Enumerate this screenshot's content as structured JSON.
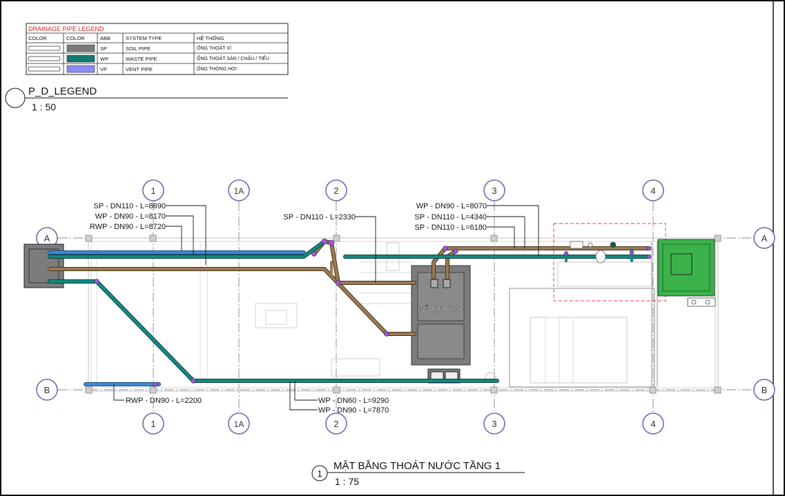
{
  "legend_table": {
    "title": "DRAINAGE PIPE LEGEND",
    "headers": [
      "COLOR",
      "COLOR",
      "ABB",
      "SYSTEM TYPE",
      "HỆ THỐNG"
    ],
    "rows": [
      {
        "abb": "SP",
        "system": "SOIL PIPE",
        "vn": "ỐNG THOÁT XÍ",
        "color": "#7a7a7a"
      },
      {
        "abb": "WP",
        "system": "WASTE PIPE",
        "vn": "ỐNG THOÁT SÀN / CHẬU / TIỂU",
        "color": "#117a73"
      },
      {
        "abb": "VP",
        "system": "VENT PIPE",
        "vn": "ỐNG THÔNG HƠI",
        "color": "#8b8cf5"
      }
    ]
  },
  "legend_view": {
    "title": "P_D_LEGEND",
    "scale": "1 : 50"
  },
  "grid": {
    "columns": [
      "1",
      "1A",
      "2",
      "3",
      "4"
    ],
    "rows": [
      "A",
      "B"
    ]
  },
  "pipe_labels": {
    "left_sp110": "SP - DN110 - L=8690",
    "left_wp90": "WP - DN90 - L=8170",
    "left_rwp90": "RWP - DN90 - L=8720",
    "mid_sp110": "SP - DN110 - L=2330",
    "right_wp90": "WP - DN90 - L=8070",
    "right_sp110_a": "SP - DN110 - L=4340",
    "right_sp110_b": "SP - DN110 - L=6180",
    "bottom_rwp90": "RWP - DN90 - L=2200",
    "bottom_wp60": "WP - DN60 - L=9290",
    "bottom_wp90": "WP - DN90 - L=7870"
  },
  "tank_label": "BỂ TỰ HOẠI",
  "plan_title": {
    "number": "1",
    "title": "MẶT BẰNG THOÁT NƯỚC TẦNG 1",
    "scale": "1 : 75"
  },
  "colors": {
    "soil_pipe": "#8a6a4a",
    "waste_pipe": "#117a73",
    "vent_pipe": "#8b8cf5",
    "rain_pipe": "#2f7fc8",
    "grid_bubble": "#6b6bb0",
    "tank": "#7c7c7c",
    "green_box": "#3cb24a",
    "red_zone": "#e04040"
  }
}
